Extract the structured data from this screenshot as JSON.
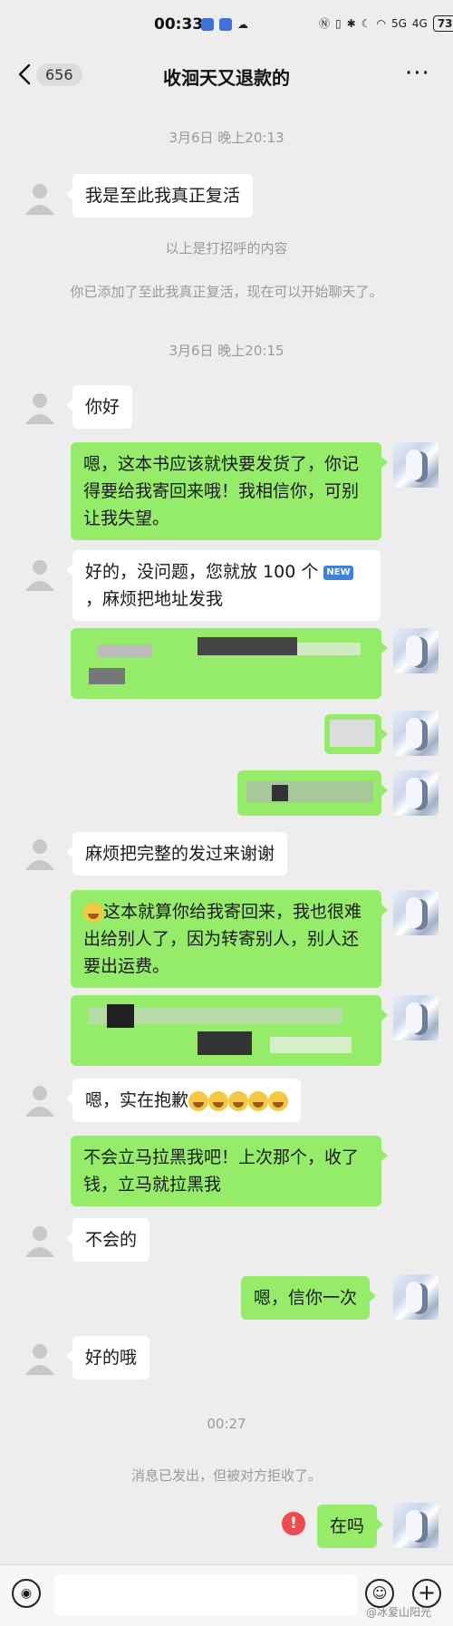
{
  "status_bar": {
    "time": "00:33",
    "signal_1": "5G",
    "signal_2": "4G",
    "battery": "73"
  },
  "header": {
    "unread_count": "656",
    "title": "收洄天又退款的"
  },
  "messages": {
    "ts1": "3月6日 晚上20:13",
    "m1": "我是至此我真正复活",
    "sys_greeting": "以上是打招呼的内容",
    "sys_added": "你已添加了至此我真正复活，现在可以开始聊天了。",
    "ts2": "3月6日 晚上20:15",
    "m2": "你好",
    "m3": "嗯，这本书应该就快要发货了，你记得要给我寄回来哦！我相信你，可别让我失望。",
    "m4a": "好的，没问题，您就放 100 个",
    "m4b": "，麻烦把地址发我",
    "new_badge": "NEW",
    "m5": "麻烦把完整的发过来谢谢",
    "m6": "这本就算你给我寄回来，我也很难出给别人了，因为转寄别人，别人还要出运费。",
    "m7": "嗯，实在抱歉",
    "m8": "不会立马拉黑我吧！上次那个，收了钱，立马就拉黑我",
    "m9": "不会的",
    "m10": "嗯，信你一次",
    "m11": "好的哦",
    "ts3": "00:27",
    "sys_rejected": "消息已发出，但被对方拒收了。",
    "m12": "在吗"
  },
  "footer": {
    "watermark": "@冰爱山阳光"
  }
}
